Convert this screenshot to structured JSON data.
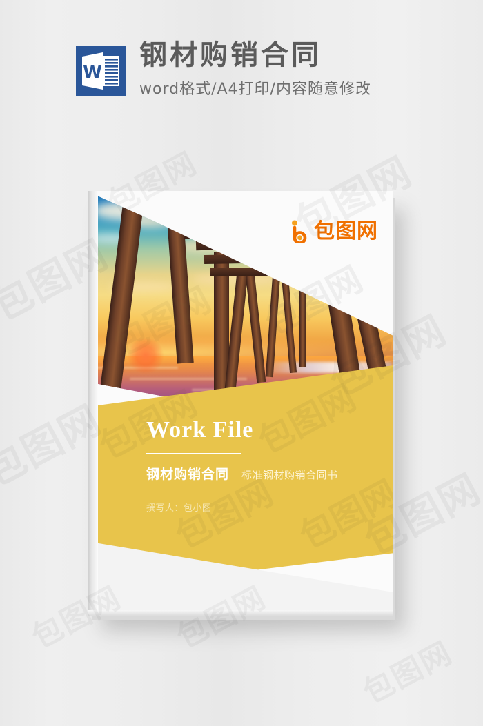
{
  "page": {
    "background_color": "#ececec",
    "watermark_text": "包图网"
  },
  "header": {
    "icon_name": "word-document-icon",
    "icon_letter": "W",
    "icon_color": "#2a5699",
    "title": "钢材购销合同",
    "subtitle": "word格式/A4打印/内容随意修改",
    "title_color": "#5b5b5b",
    "subtitle_color": "#6e6e6e"
  },
  "cover": {
    "accent_color": "#e8c44b",
    "logo": {
      "mark_name": "baotu-b-logo-icon",
      "text": "包图网",
      "color": "#f07000"
    },
    "photo": {
      "alt": "sunset-under-pier-photo",
      "description": "Wooden pier pillars over ocean water at sunset"
    },
    "headline": "Work File",
    "title": "钢材购销合同",
    "subtitle": "标准钢材购销合同书",
    "author": "撰写人：包小图",
    "watermark_text": "包图网"
  }
}
